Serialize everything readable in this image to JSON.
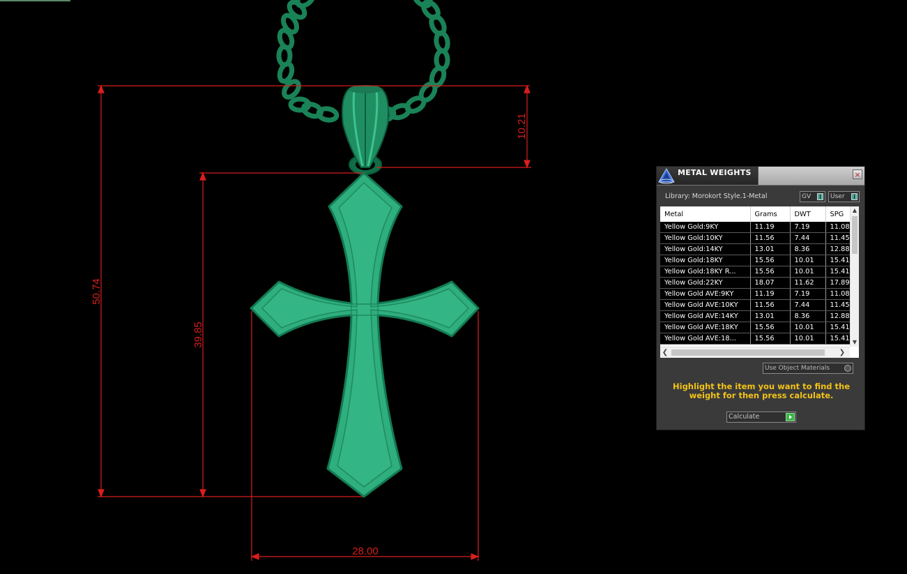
{
  "dimensions": {
    "total_height": "50.74",
    "cross_height": "39.85",
    "bail_height": "10.21",
    "width": "28.00"
  },
  "colors": {
    "dimension_line": "#d81e1e",
    "cross_fill": "#2fae7e",
    "cross_edge": "#127a52",
    "chain": "#1d8a5c",
    "hint_text": "#f2c318"
  },
  "panel": {
    "title": "METAL WEIGHTS",
    "icon": "app-logo-icon",
    "close_label": "×",
    "library_label": "Library: Morokort Style.1-Metal",
    "gv_label": "GV",
    "user_label": "User",
    "table": {
      "columns": [
        "Metal",
        "Grams",
        "DWT",
        "SPG"
      ],
      "rows": [
        [
          "Yellow Gold:9KY",
          "11.19",
          "7.19",
          "11.08"
        ],
        [
          "Yellow Gold:10KY",
          "11.56",
          "7.44",
          "11.45"
        ],
        [
          "Yellow Gold:14KY",
          "13.01",
          "8.36",
          "12.88"
        ],
        [
          "Yellow Gold:18KY",
          "15.56",
          "10.01",
          "15.41"
        ],
        [
          "Yellow Gold:18KY R...",
          "15.56",
          "10.01",
          "15.41"
        ],
        [
          "Yellow Gold:22KY",
          "18.07",
          "11.62",
          "17.89"
        ],
        [
          "Yellow Gold AVE:9KY",
          "11.19",
          "7.19",
          "11.08"
        ],
        [
          "Yellow Gold AVE:10KY",
          "11.56",
          "7.44",
          "11.45"
        ],
        [
          "Yellow Gold AVE:14KY",
          "13.01",
          "8.36",
          "12.88"
        ],
        [
          "Yellow Gold AVE:18KY",
          "15.56",
          "10.01",
          "15.41"
        ],
        [
          "Yellow Gold AVE:18...",
          "15.56",
          "10.01",
          "15.41"
        ]
      ]
    },
    "use_object_materials_label": "Use Object Materials",
    "hint": "Highlight the item you want to find the weight for then press calculate.",
    "calculate_label": "Calculate"
  }
}
